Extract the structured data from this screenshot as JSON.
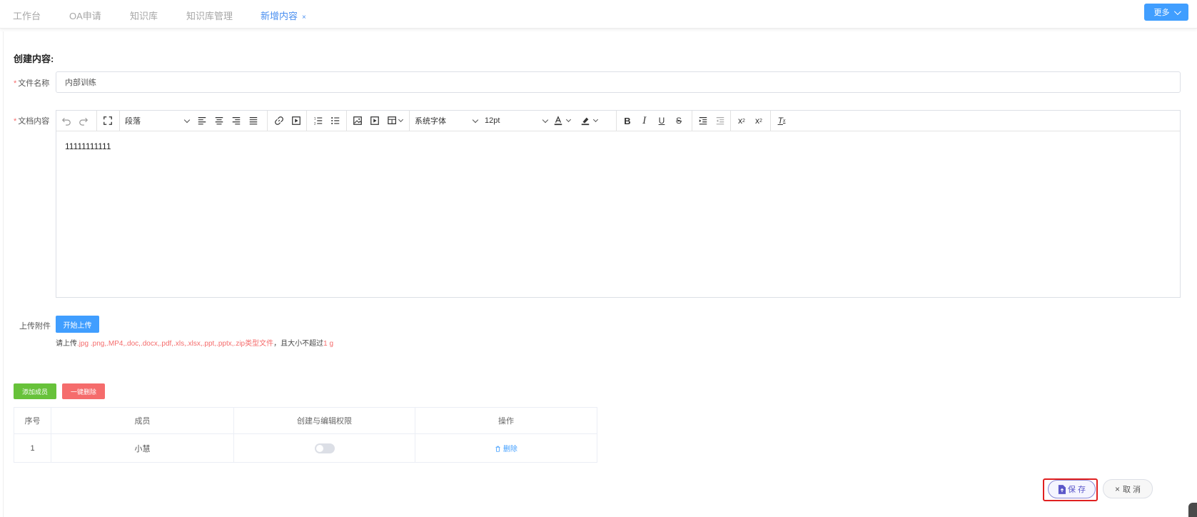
{
  "tabs": [
    {
      "label": "工作台"
    },
    {
      "label": "OA申请"
    },
    {
      "label": "知识库"
    },
    {
      "label": "知识库管理"
    },
    {
      "label": "新增内容",
      "close": "×"
    }
  ],
  "more_button": "更多",
  "form": {
    "title": "创建内容:",
    "required_mark": "*",
    "filename_label": "文件名称",
    "filename_value": "内部训练",
    "content_label": "文档内容",
    "upload_label": "上传附件"
  },
  "editor": {
    "block_format": "段落",
    "font_family": "系统字体",
    "font_size": "12pt",
    "body_text": "11111111111"
  },
  "upload": {
    "button": "开始上传",
    "hint_prefix": "请上传",
    "hint_types": ".jpg .png,.MP4,.doc,.docx,.pdf,.xls,.xlsx,.ppt,.pptx,.zip类型文件",
    "hint_middle": "，且大小不超过",
    "hint_size": "1 g"
  },
  "members": {
    "add_button": "添加成员",
    "delete_all_button": "一键删除",
    "columns": [
      "序号",
      "成员",
      "创建与编辑权限",
      "操作"
    ],
    "rows": [
      {
        "index": "1",
        "name": "小慧",
        "permission_on": false,
        "action": "删除"
      }
    ]
  },
  "actions": {
    "save": "保 存",
    "cancel": "取 消"
  },
  "colors": {
    "primary": "#409eff",
    "success": "#67c23a",
    "danger": "#f56c6c",
    "highlight": "#e02020"
  }
}
